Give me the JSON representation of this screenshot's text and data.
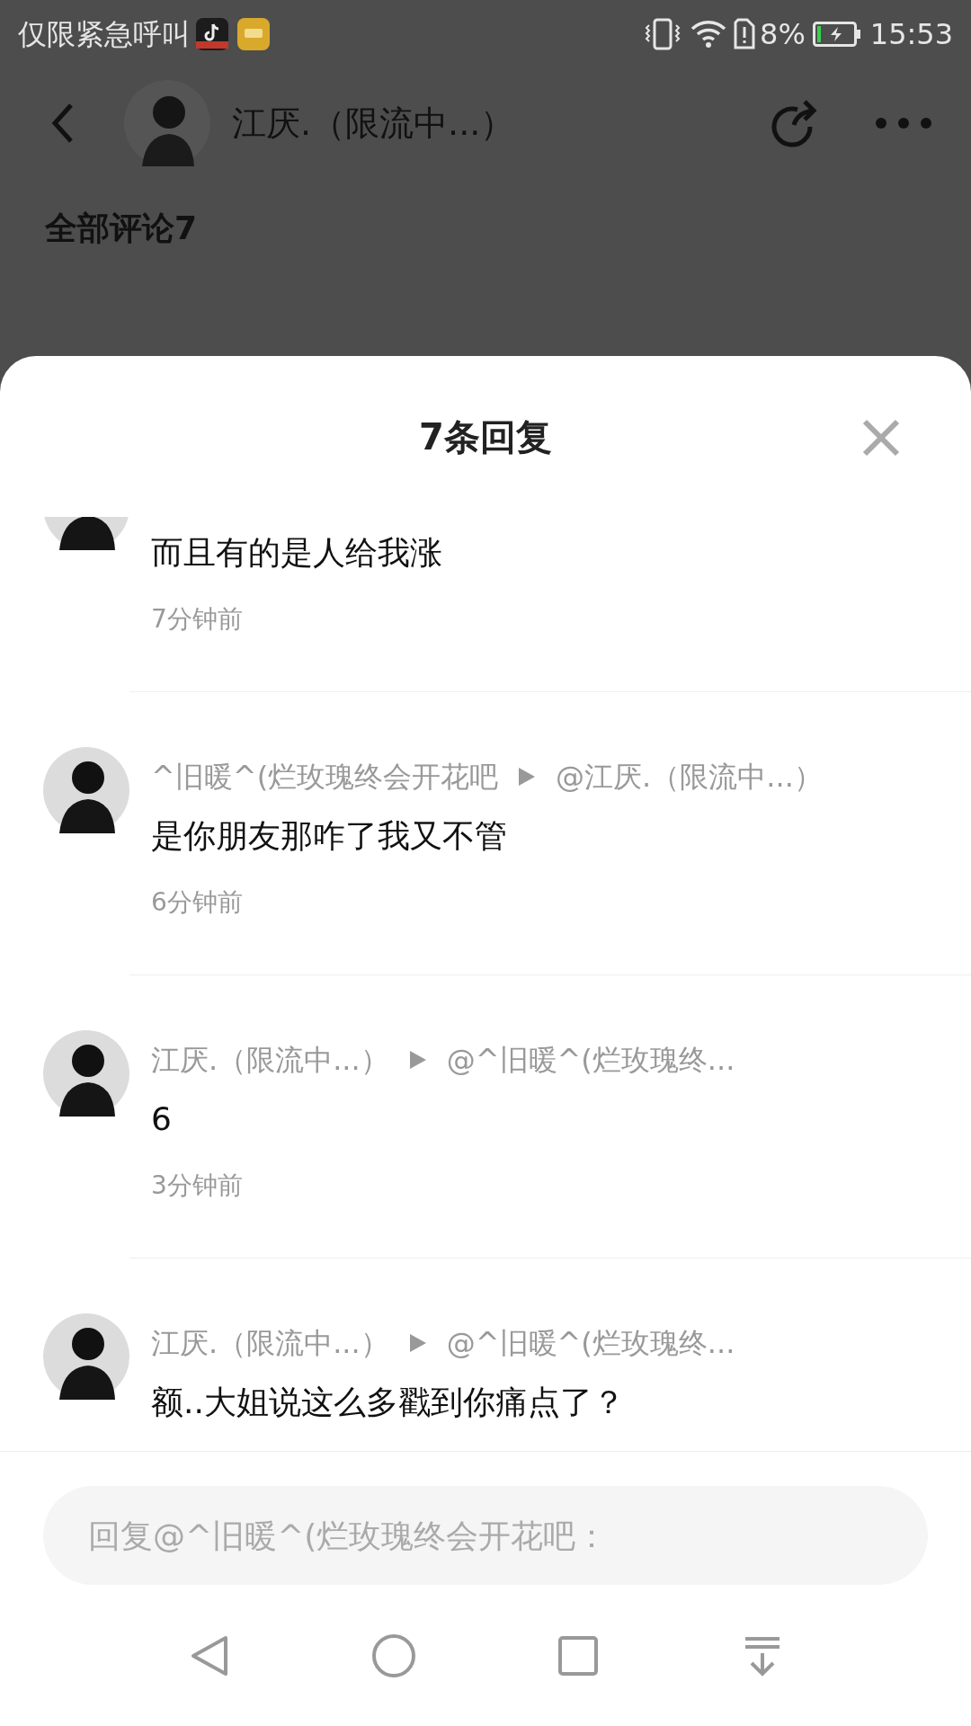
{
  "status_bar": {
    "notice": "仅限紧急呼叫",
    "battery_percent": "8%",
    "time": "15:53"
  },
  "header": {
    "title": "江厌.（限流中...）"
  },
  "section_title": "全部评论7",
  "sheet": {
    "title": "7条回复"
  },
  "replies": [
    {
      "text": "而且有的是人给我涨",
      "time": "7分钟前"
    },
    {
      "author": "^旧暖^(烂玫瑰终会开花吧",
      "reply_to": "@江厌.（限流中...）",
      "text": "是你朋友那咋了我又不管",
      "time": "6分钟前"
    },
    {
      "author": "江厌.（限流中...）",
      "reply_to": "@^旧暖^(烂玫瑰终...",
      "text": "6",
      "time": "3分钟前"
    },
    {
      "author": "江厌.（限流中...）",
      "reply_to": "@^旧暖^(烂玫瑰终...",
      "text": "额..大姐说这么多戳到你痛点了？"
    }
  ],
  "reply_input": {
    "placeholder": "回复@^旧暖^(烂玫瑰终会开花吧："
  }
}
